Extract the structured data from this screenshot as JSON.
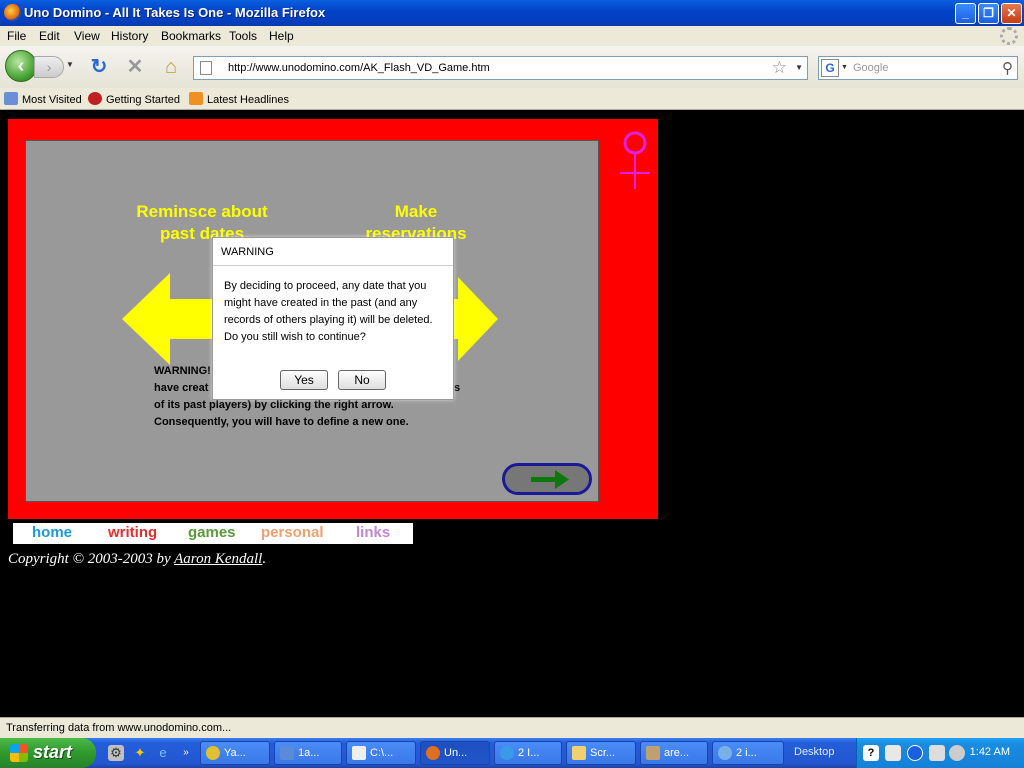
{
  "window": {
    "title": "Uno Domino - All It Takes Is One - Mozilla Firefox"
  },
  "menu": [
    "File",
    "Edit",
    "View",
    "History",
    "Bookmarks",
    "Tools",
    "Help"
  ],
  "nav": {
    "url": "http://www.unodomino.com/AK_Flash_VD_Game.htm",
    "search_placeholder": "Google"
  },
  "bookmarks": [
    "Most Visited",
    "Getting Started",
    "Latest Headlines"
  ],
  "game": {
    "left_label_line1": "Reminsce about",
    "left_label_line2": "past dates",
    "right_label_line1": "Make",
    "right_label_line2": "reservations",
    "warning_lines": [
      "WARNING!",
      "have creat",
      "of its past players) by clicking the right arrow.",
      "Consequently, you will have to define a new one."
    ],
    "warning_right_fragment": "s"
  },
  "dialog": {
    "title": "WARNING",
    "message": "By deciding to proceed, any date that you might have created in the past (and any records of others playing it) will be deleted.  Do you still wish to continue?",
    "yes_label": "Yes",
    "no_label": "No"
  },
  "site_nav": {
    "items": [
      {
        "label": "home",
        "color": "#1f9ad6"
      },
      {
        "label": "writing",
        "color": "#e03030"
      },
      {
        "label": "games",
        "color": "#5a9a3a"
      },
      {
        "label": "personal",
        "color": "#f0a070"
      },
      {
        "label": "links",
        "color": "#c088d0"
      }
    ]
  },
  "copyright": {
    "prefix": "Copyright © 2003-2003 by ",
    "author": "Aaron Kendall",
    "suffix": "."
  },
  "status": "Transferring data from www.unodomino.com...",
  "taskbar": {
    "start": "start",
    "items": [
      "Ya...",
      "1a...",
      "C:\\...",
      "Un...",
      "2 I...",
      "Scr...",
      "are...",
      "2 i..."
    ],
    "desktop": "Desktop",
    "clock": "1:42 AM"
  }
}
